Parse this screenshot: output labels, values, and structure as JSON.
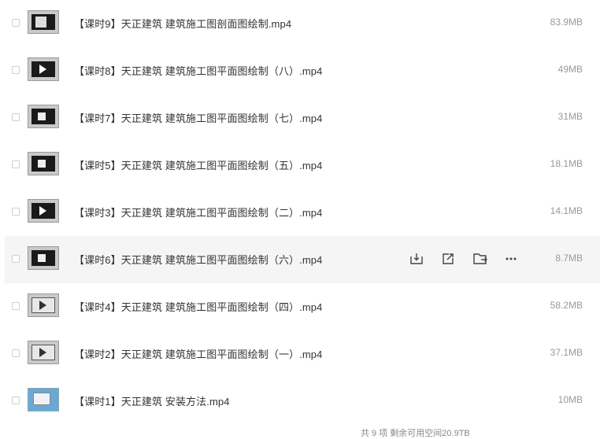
{
  "files": [
    {
      "name": "【课时9】天正建筑 建筑施工图剖面图绘制.mp4",
      "size": "83.9MB",
      "thumb": "dark-light"
    },
    {
      "name": "【课时8】天正建筑 建筑施工图平面图绘制（八）.mp4",
      "size": "49MB",
      "thumb": "dark-play"
    },
    {
      "name": "【课时7】天正建筑 建筑施工图平面图绘制（七）.mp4",
      "size": "31MB",
      "thumb": "dark"
    },
    {
      "name": "【课时5】天正建筑 建筑施工图平面图绘制（五）.mp4",
      "size": "18.1MB",
      "thumb": "dark"
    },
    {
      "name": "【课时3】天正建筑 建筑施工图平面图绘制（二）.mp4",
      "size": "14.1MB",
      "thumb": "dark-play"
    },
    {
      "name": "【课时6】天正建筑 建筑施工图平面图绘制（六）.mp4",
      "size": "8.7MB",
      "thumb": "dark"
    },
    {
      "name": "【课时4】天正建筑 建筑施工图平面图绘制（四）.mp4",
      "size": "58.2MB",
      "thumb": "light-play"
    },
    {
      "name": "【课时2】天正建筑 建筑施工图平面图绘制（一）.mp4",
      "size": "37.1MB",
      "thumb": "light-play"
    },
    {
      "name": "【课时1】天正建筑 安装方法.mp4",
      "size": "10MB",
      "thumb": "desktop"
    }
  ],
  "hovered_row_index": 5,
  "row_actions": [
    {
      "icon": "download-icon"
    },
    {
      "icon": "share-icon"
    },
    {
      "icon": "move-folder-icon"
    },
    {
      "icon": "more-icon"
    }
  ],
  "footer": {
    "text": "共 9 项 剩余可用空间20.9TB"
  },
  "colors": {
    "hover_bg": "#f5f5f6",
    "text": "#333333",
    "size_text": "#999999"
  }
}
